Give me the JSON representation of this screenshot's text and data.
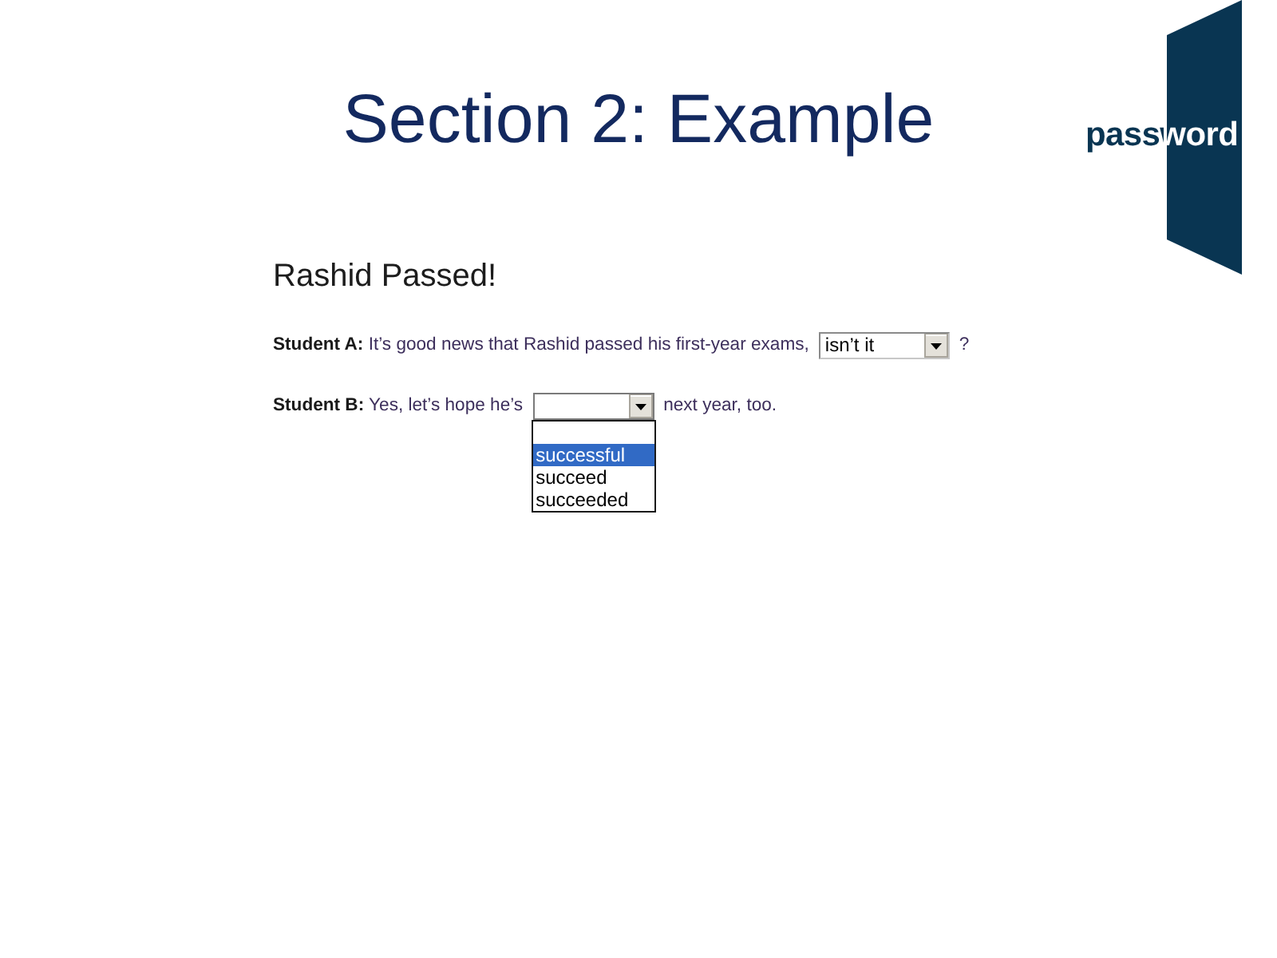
{
  "slide": {
    "title": "Section 2: Example"
  },
  "logo": {
    "text": "password"
  },
  "exercise": {
    "title": "Rashid Passed!",
    "lines": [
      {
        "prompt": "**Student A:** It’s good news that Rashid passed his first-year exams,",
        "dropdown": {
          "value": "isn’t it",
          "expanded": false
        },
        "after": "?"
      },
      {
        "prompt": "**Student B:** Yes, let’s hope he’s",
        "dropdown": {
          "expanded": true,
          "options": [
            {
              "kind": "blank",
              "selected": false
            },
            {
              "kind": "text",
              "label": "successful",
              "selected": true
            },
            {
              "kind": "text",
              "label": "succeed",
              "selected": false
            },
            {
              "kind": "text",
              "label": "succeeded",
              "selected": false
            }
          ]
        },
        "after": "next year, too."
      }
    ]
  }
}
